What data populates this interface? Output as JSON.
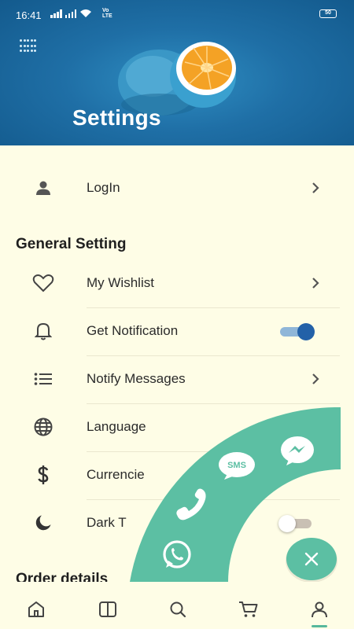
{
  "status_bar": {
    "time": "16:41",
    "network_label": "Vo LTE",
    "battery": "50"
  },
  "header": {
    "title": "Settings",
    "menu_icon": "dots-grid-icon",
    "background_color": "#1f6fa6"
  },
  "login": {
    "label": "LogIn",
    "icon": "person-icon"
  },
  "general_setting": {
    "title": "General Setting",
    "items": [
      {
        "label": "My Wishlist",
        "icon": "heart-icon",
        "trailing": "chevron"
      },
      {
        "label": "Get Notification",
        "icon": "bell-icon",
        "trailing": "toggle",
        "toggle_on": true
      },
      {
        "label": "Notify Messages",
        "icon": "list-icon",
        "trailing": "chevron"
      },
      {
        "label": "Language",
        "icon": "globe-icon",
        "trailing": "none"
      },
      {
        "label": "Currencie",
        "icon": "dollar-icon",
        "trailing": "none"
      },
      {
        "label": "Dark T",
        "icon": "moon-icon",
        "trailing": "toggle",
        "toggle_on": false
      }
    ]
  },
  "order_details": {
    "title": "Order details"
  },
  "contact_menu": {
    "sms_label": "SMS",
    "actions": [
      "messenger-icon",
      "sms-icon",
      "phone-icon",
      "whatsapp-icon"
    ],
    "close_icon": "close-icon",
    "color": "#5cbfa3"
  },
  "bottom_nav": {
    "items": [
      "home-icon",
      "book-icon",
      "search-icon",
      "cart-icon",
      "profile-icon"
    ],
    "active": "profile-icon",
    "active_color": "#56b89c"
  }
}
